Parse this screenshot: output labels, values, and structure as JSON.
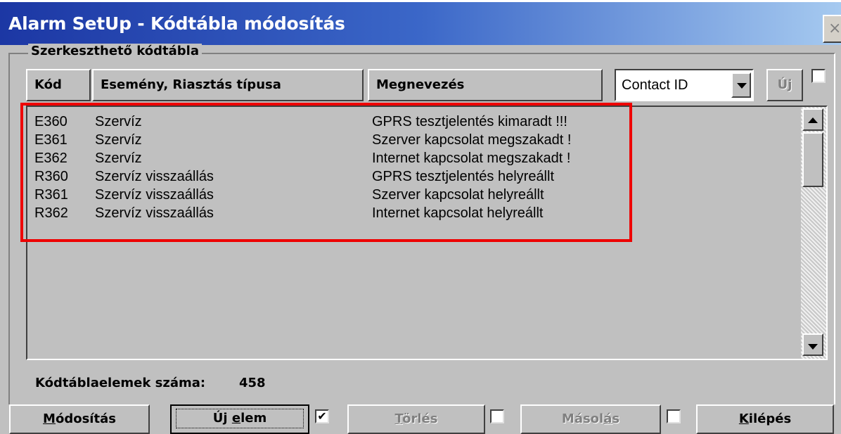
{
  "window": {
    "title": "Alarm SetUp - Kódtábla módosítás",
    "close_label": "×"
  },
  "group": {
    "label": "Szerkeszthető kódtábla"
  },
  "columns": {
    "kod": "Kód",
    "esemeny": "Esemény, Riasztás típusa",
    "megnevezes": "Megnevezés"
  },
  "protocol": {
    "selected": "Contact ID"
  },
  "uj_button": {
    "label": "Új",
    "checked": false
  },
  "rows": [
    {
      "kod": "E360",
      "esemeny": "Szervíz",
      "megnevezes": "GPRS tesztjelentés kimaradt !!!"
    },
    {
      "kod": "E361",
      "esemeny": "Szervíz",
      "megnevezes": "Szerver kapcsolat megszakadt !"
    },
    {
      "kod": "E362",
      "esemeny": "Szervíz",
      "megnevezes": "Internet kapcsolat megszakadt !"
    },
    {
      "kod": "R360",
      "esemeny": "Szervíz visszaállás",
      "megnevezes": "GPRS tesztjelentés helyreállt"
    },
    {
      "kod": "R361",
      "esemeny": "Szervíz visszaállás",
      "megnevezes": "Szerver kapcsolat helyreállt"
    },
    {
      "kod": "R362",
      "esemeny": "Szervíz visszaállás",
      "megnevezes": "Internet kapcsolat helyreállt"
    }
  ],
  "status": {
    "count_label": "Kódtáblaelemek száma:",
    "count_value": "458"
  },
  "buttons": {
    "modositas": {
      "pre": "",
      "ul": "M",
      "post": "ódosítás"
    },
    "uj_elem": {
      "pre": "Új ",
      "ul": "e",
      "post": "lem",
      "checked": true
    },
    "torles": {
      "pre": "",
      "ul": "T",
      "post": "örlés",
      "checked": false
    },
    "masolas": {
      "pre": "Másol",
      "ul": "á",
      "post": "s",
      "checked": false
    },
    "kilepes": {
      "pre": "",
      "ul": "K",
      "post": "ilépés"
    }
  },
  "highlight_color": "#ee0000",
  "icons": {
    "scroll_up": "arrow-up-icon",
    "scroll_down": "arrow-down-icon",
    "combo": "chevron-down-icon",
    "check": "checkmark-icon"
  }
}
